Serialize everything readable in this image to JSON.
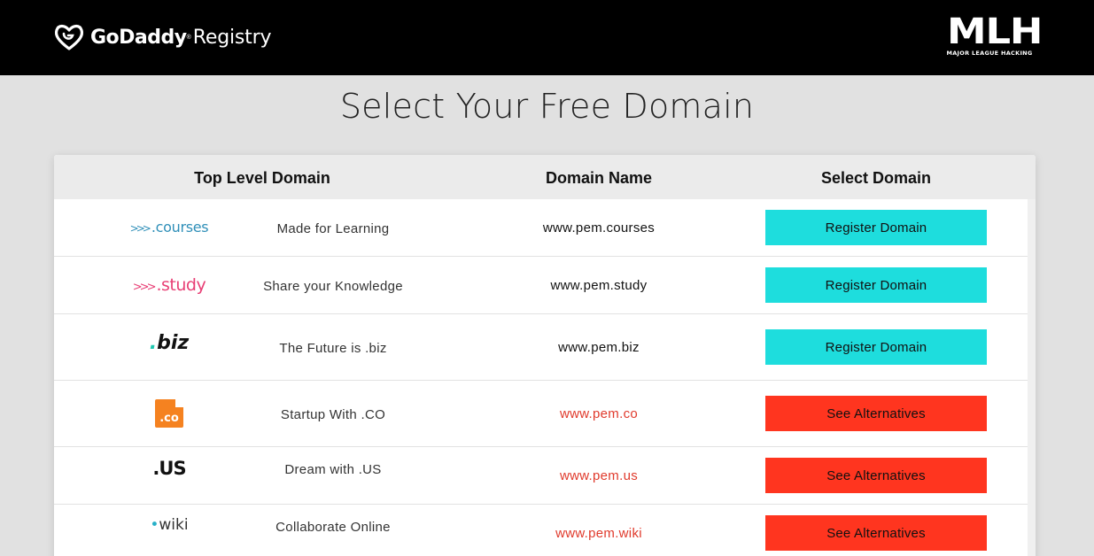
{
  "header": {
    "brand": "GoDaddy",
    "brand_sup": "®",
    "brand_sub": "Registry",
    "mlh_big": "MLH",
    "mlh_small": "MAJOR LEAGUE HACKING"
  },
  "page_title": "Select Your Free Domain",
  "table": {
    "headers": {
      "tld": "Top Level Domain",
      "name": "Domain Name",
      "select": "Select Domain"
    },
    "rows": [
      {
        "logo": ".courses",
        "logo_icon": "courses-logo",
        "description": "Made for Learning",
        "domain": "www.pem.courses",
        "status": "available",
        "button": "Register Domain"
      },
      {
        "logo": ".study",
        "logo_icon": "study-logo",
        "description": "Share your Knowledge",
        "domain": "www.pem.study",
        "status": "available",
        "button": "Register Domain"
      },
      {
        "logo": ".biz",
        "logo_icon": "biz-logo",
        "description": "The Future is .biz",
        "domain": "www.pem.biz",
        "status": "available",
        "button": "Register Domain"
      },
      {
        "logo": ".co",
        "logo_icon": "co-logo",
        "description": "Startup With .CO",
        "domain": "www.pem.co",
        "status": "taken",
        "button": "See Alternatives"
      },
      {
        "logo": ".US",
        "logo_icon": "us-logo",
        "description": "Dream with .US",
        "domain": "www.pem.us",
        "status": "taken",
        "button": "See Alternatives"
      },
      {
        "logo": "wiki",
        "logo_icon": "wiki-logo",
        "description": "Collaborate Online",
        "domain": "www.pem.wiki",
        "status": "taken",
        "button": "See Alternatives"
      }
    ]
  },
  "colors": {
    "register_button": "#1edddd",
    "alternatives_button": "#ff351f",
    "taken_domain_text": "#e03a2c"
  }
}
